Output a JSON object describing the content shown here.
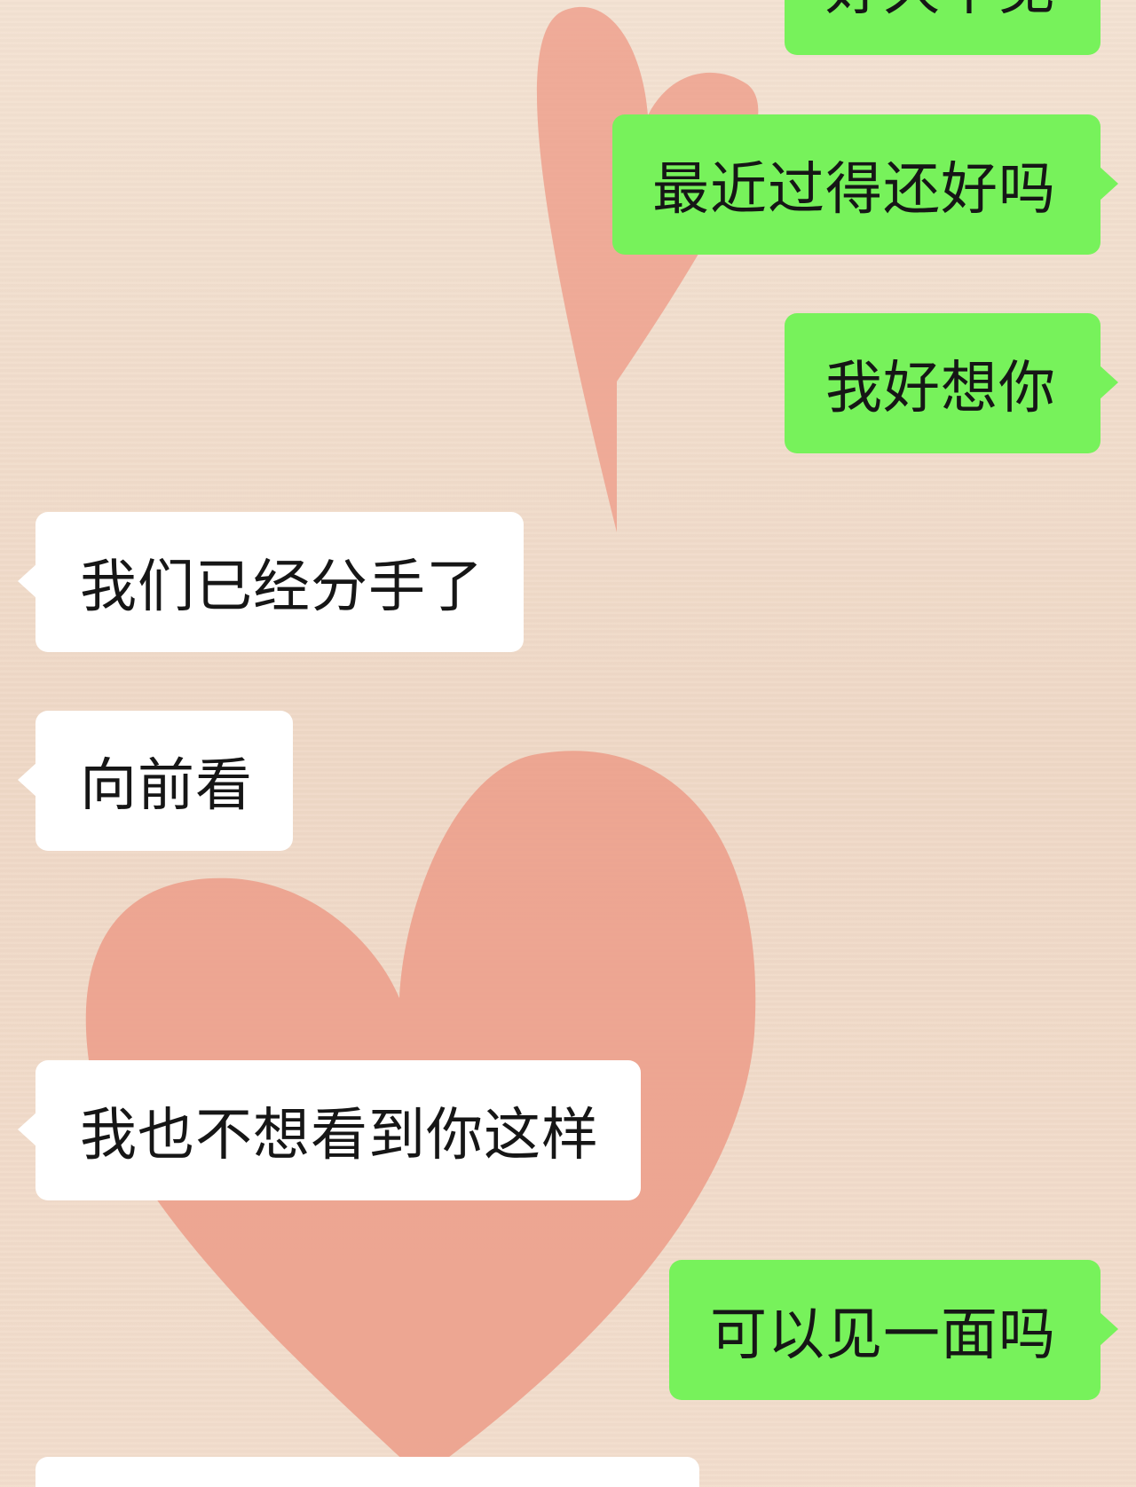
{
  "chat": {
    "messages": [
      {
        "side": "sent",
        "text": "好久不见"
      },
      {
        "side": "sent",
        "text": "最近过得还好吗"
      },
      {
        "side": "sent",
        "text": "我好想你"
      },
      {
        "side": "recv",
        "text": "我们已经分手了"
      },
      {
        "side": "recv",
        "text": "向前看"
      },
      {
        "side": "recv",
        "text": "我也不想看到你这样"
      },
      {
        "side": "sent",
        "text": "可以见一面吗"
      },
      {
        "side": "recv",
        "text": ""
      }
    ]
  },
  "colors": {
    "background": "#f2dfcd",
    "sent_bubble": "#77f25b",
    "received_bubble": "#ffffff",
    "heart": "#eca08c"
  },
  "icons": [
    "heart-icon"
  ]
}
